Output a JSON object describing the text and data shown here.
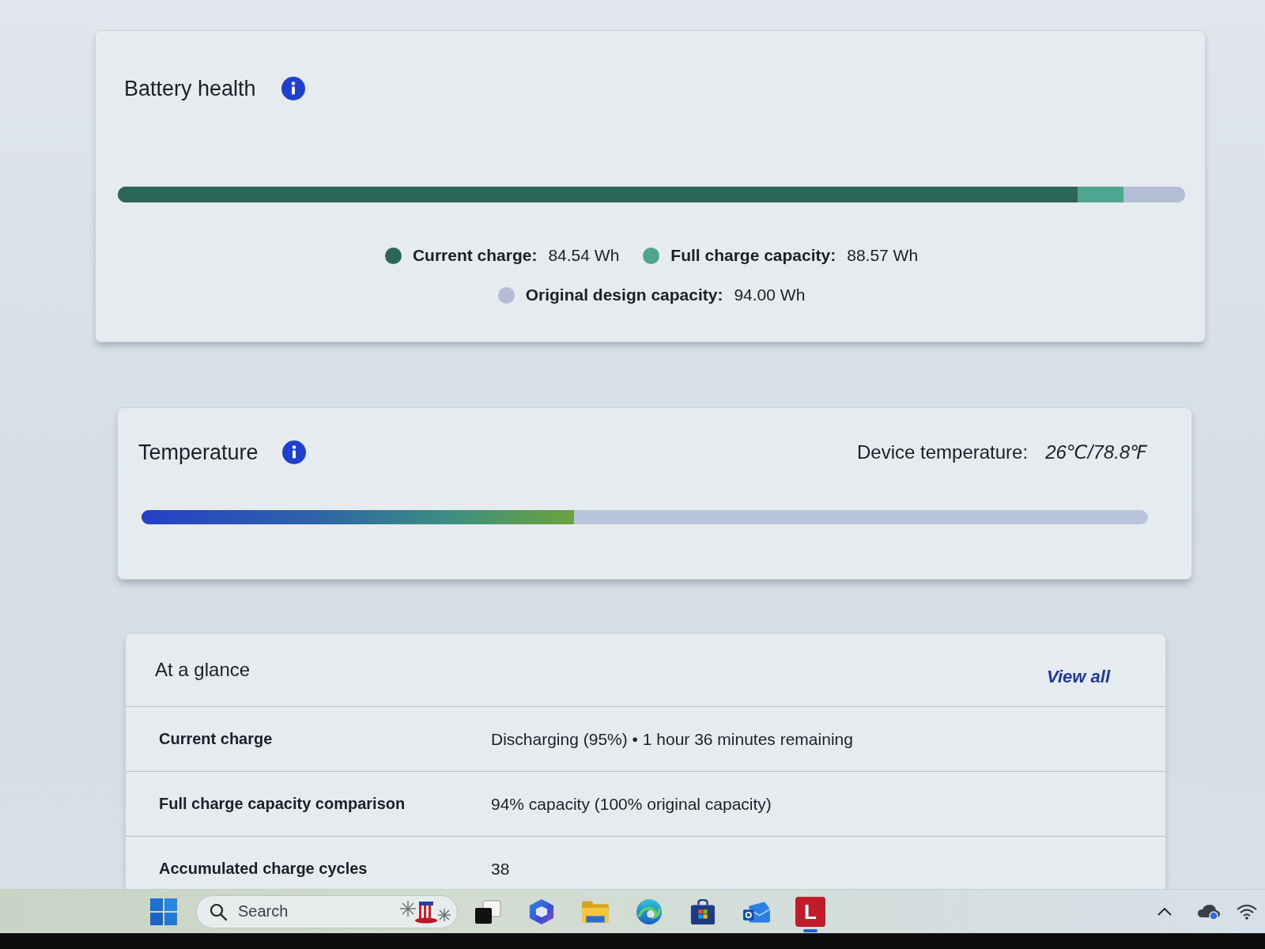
{
  "battery_health": {
    "title": "Battery health",
    "legend": [
      {
        "label": "Current charge:",
        "value": "84.54 Wh",
        "color": "#2b6657",
        "level": 0.899
      },
      {
        "label": "Full charge capacity:",
        "value": "88.57 Wh",
        "color": "#4fa690",
        "level": 0.942
      },
      {
        "label": "Original design capacity:",
        "value": "94.00 Wh",
        "color": "#b3bdd6",
        "level": 1
      }
    ]
  },
  "temperature": {
    "title": "Temperature",
    "reading_label": "Device temperature:",
    "reading": "26℃/78.8℉",
    "level": 0.43
  },
  "at_a_glance": {
    "title": "At a glance",
    "link": "View all",
    "rows": [
      {
        "label": "Current charge",
        "value": "Discharging (95%) • 1 hour 36 minutes remaining"
      },
      {
        "label": "Full charge capacity comparison",
        "value": "94% capacity (100% original capacity)"
      },
      {
        "label": "Accumulated charge cycles",
        "value": "38"
      }
    ]
  },
  "taskbar": {
    "search": {
      "placeholder": "Search"
    },
    "apps": [
      {
        "kind": "task-view",
        "active": false
      },
      {
        "kind": "assistant",
        "active": false
      },
      {
        "kind": "files",
        "active": false
      },
      {
        "kind": "browser",
        "active": false
      },
      {
        "kind": "store",
        "active": false
      },
      {
        "kind": "mail",
        "active": false
      },
      {
        "kind": "letter",
        "label": "L",
        "active": true
      }
    ]
  }
}
